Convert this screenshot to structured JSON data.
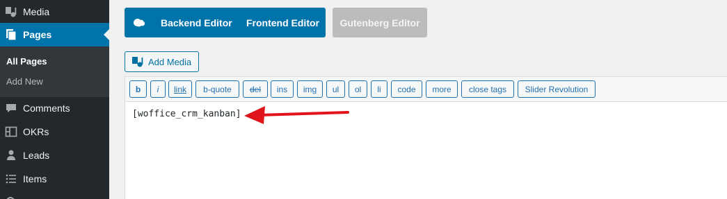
{
  "sidebar": {
    "items": [
      {
        "label": "Media",
        "icon": "media-icon"
      },
      {
        "label": "Pages",
        "icon": "pages-icon"
      },
      {
        "label": "Comments",
        "icon": "comments-icon"
      },
      {
        "label": "OKRs",
        "icon": "okrs-icon"
      },
      {
        "label": "Leads",
        "icon": "leads-icon"
      },
      {
        "label": "Items",
        "icon": "items-icon"
      }
    ],
    "submenu": [
      {
        "label": "All Pages"
      },
      {
        "label": "Add New"
      }
    ]
  },
  "editor_switch": {
    "backend_label": "Backend Editor",
    "frontend_label": "Frontend Editor",
    "gutenberg_label": "Gutenberg Editor"
  },
  "add_media_label": "Add Media",
  "quicktags": [
    "b",
    "i",
    "link",
    "b-quote",
    "del",
    "ins",
    "img",
    "ul",
    "ol",
    "li",
    "code",
    "more",
    "close tags",
    "Slider Revolution"
  ],
  "content_text": "[woffice_crm_kanban]",
  "colors": {
    "sidebar_bg": "#23282d",
    "accent": "#0073aa",
    "arrow": "#e0141c"
  }
}
